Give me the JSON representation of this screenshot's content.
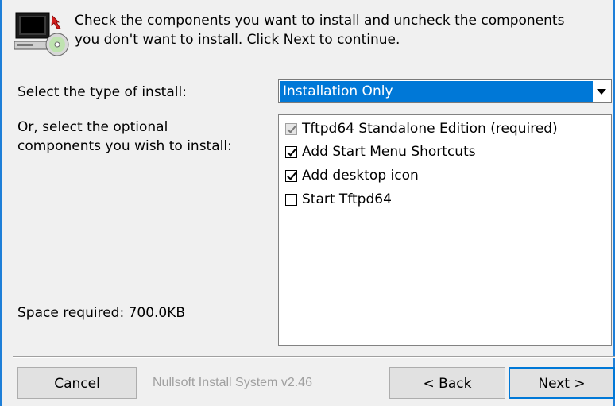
{
  "header": {
    "icon": "installer-computer-cd-icon",
    "text_line1": "Check the components you want to install and uncheck the components",
    "text_line2": "you don't want to install. Click Next to continue."
  },
  "install_type": {
    "label": "Select the type of install:",
    "selected": "Installation Only"
  },
  "components": {
    "label_line1": "Or, select the optional",
    "label_line2": "components you wish to install:",
    "items": [
      {
        "label": "Tftpd64 Standalone Edition (required)",
        "checked": true,
        "disabled": true
      },
      {
        "label": "Add Start Menu Shortcuts",
        "checked": true,
        "disabled": false
      },
      {
        "label": "Add desktop icon",
        "checked": true,
        "disabled": false
      },
      {
        "label": "Start Tftpd64",
        "checked": false,
        "disabled": false
      }
    ]
  },
  "space_required": "Space required: 700.0KB",
  "footer": {
    "cancel_label": "Cancel",
    "branding": "Nullsoft Install System v2.46",
    "back_label": "< Back",
    "next_label": "Next >"
  },
  "colors": {
    "accent": "#0078d7",
    "window_border": "#1e7fd8",
    "background": "#f0f0f0"
  }
}
